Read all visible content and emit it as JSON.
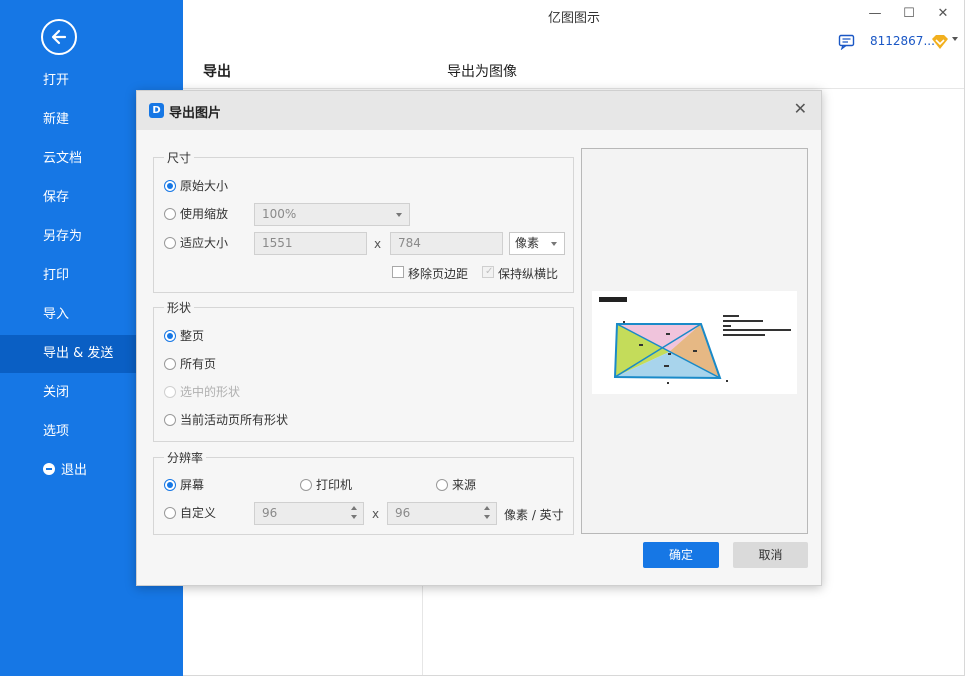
{
  "app": {
    "title": "亿图图示"
  },
  "window_controls": {
    "minimize": "—",
    "maximize": "☐",
    "close": "✕"
  },
  "user": {
    "id_text": "8112867..."
  },
  "sidebar": {
    "items": [
      {
        "label": "打开"
      },
      {
        "label": "新建"
      },
      {
        "label": "云文档"
      },
      {
        "label": "保存"
      },
      {
        "label": "另存为"
      },
      {
        "label": "打印"
      },
      {
        "label": "导入"
      },
      {
        "label": "导出 & 发送",
        "active": true
      },
      {
        "label": "关闭"
      },
      {
        "label": "选项"
      },
      {
        "label": "退出"
      }
    ]
  },
  "main": {
    "section_title": "导出",
    "sub_title": "导出为图像"
  },
  "dialog": {
    "title": "导出图片",
    "close_glyph": "✕",
    "size_group": {
      "label": "尺寸",
      "original_size": "原始大小",
      "use_zoom": "使用缩放",
      "zoom_value": "100%",
      "fit_size": "适应大小",
      "width": "1551",
      "height": "784",
      "times": "x",
      "unit": "像素",
      "remove_margin": "移除页边距",
      "keep_ratio": "保持纵横比",
      "selected": "original_size"
    },
    "shape_group": {
      "label": "形状",
      "whole_page": "整页",
      "all_pages": "所有页",
      "selected_shapes": "选中的形状",
      "active_page_shapes": "当前活动页所有形状",
      "selected": "whole_page"
    },
    "resolution_group": {
      "label": "分辨率",
      "screen": "屏幕",
      "printer": "打印机",
      "source": "来源",
      "custom": "自定义",
      "dpi_x": "96",
      "dpi_y": "96",
      "times": "x",
      "unit": "像素 / 英寸",
      "selected": "screen"
    },
    "ok_label": "确定",
    "cancel_label": "取消"
  },
  "colors": {
    "sidebar": "#1677e5",
    "sidebar_active": "#0a5fc4",
    "accent": "#1677e5",
    "trap_pink": "#f0c4dc",
    "trap_green": "#c4dc5a",
    "trap_orange": "#e6b884",
    "trap_blue": "#a8d4ec",
    "trap_stroke": "#1a8ac8"
  }
}
